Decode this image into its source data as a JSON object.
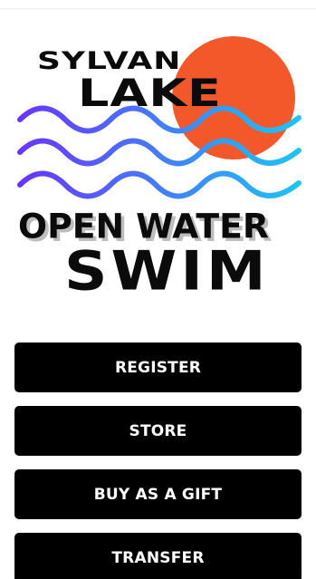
{
  "logo": {
    "line1": "SYLVAN",
    "line2": "LAKE",
    "line3": "OPEN WATER",
    "line4": "SWIM",
    "sun_color": "#f2582a",
    "wave_color_start": "#6a35ff",
    "wave_color_end": "#1fc4f0"
  },
  "buttons": {
    "register": "REGISTER",
    "store": "STORE",
    "gift": "BUY AS A GIFT",
    "transfer": "TRANSFER"
  }
}
